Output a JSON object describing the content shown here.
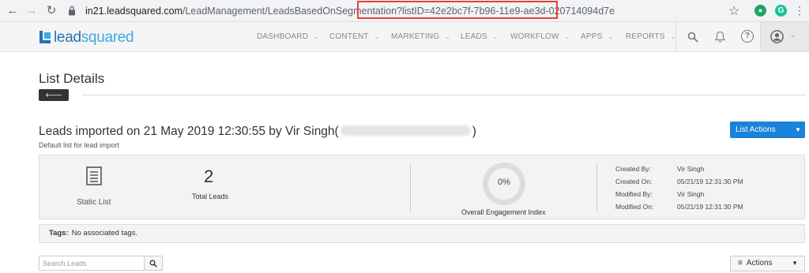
{
  "browser": {
    "back_glyph": "←",
    "forward_glyph": "→",
    "reload_glyph": "↻",
    "url_host": "in21.leadsquared.com",
    "url_path": "/LeadManagement/LeadsBasedOnSegmentation",
    "url_query": "?listID=42e2bc7f-7b96-11e9-ae3d-020714094d7e",
    "star_glyph": "☆",
    "ext1_glyph": "●",
    "ext2_glyph": "G",
    "menu_glyph": "⋮"
  },
  "app": {
    "logo_part1": "lead",
    "logo_part2": "squared",
    "brand_color": "#2a6fb6",
    "accent_color": "#1a82d9",
    "menu": [
      {
        "label": "DASHBOARD"
      },
      {
        "label": "CONTENT"
      },
      {
        "label": "MARKETING"
      },
      {
        "label": "LEADS"
      },
      {
        "label": "WORKFLOW"
      },
      {
        "label": "APPS"
      },
      {
        "label": "REPORTS"
      }
    ],
    "caret_glyph": "⌄",
    "header_icons": [
      "search-icon",
      "bell-icon",
      "help-icon",
      "user-icon"
    ],
    "help_glyph": "?"
  },
  "page": {
    "title": "List Details",
    "back_label": "Back",
    "back_arrow": "🡐",
    "lead_title": "Leads imported on 21 May 2019 12:30:55 by Vir Singh(",
    "lead_title_end": ")",
    "subtitle": "Default list for lead import",
    "list_actions_label": "List Actions",
    "caret_down": "▼"
  },
  "summary": {
    "list_type": "Static List",
    "total_count": "2",
    "total_label": "Total Leads",
    "engagement_value": "0%",
    "engagement_label": "Overall Engagement Index",
    "meta": [
      {
        "key": "Created By:",
        "value": "Vir Singh"
      },
      {
        "key": "Created On:",
        "value": "05/21/19 12:31:30 PM"
      },
      {
        "key": "Modified By:",
        "value": "Vir Singh"
      },
      {
        "key": "Modified On:",
        "value": "05/21/19 12:31:30 PM"
      }
    ]
  },
  "tags": {
    "label": "Tags:",
    "value": "No associated tags."
  },
  "controls": {
    "search_placeholder": "Search Leads",
    "actions_label": "Actions",
    "actions_bars": "≡"
  }
}
